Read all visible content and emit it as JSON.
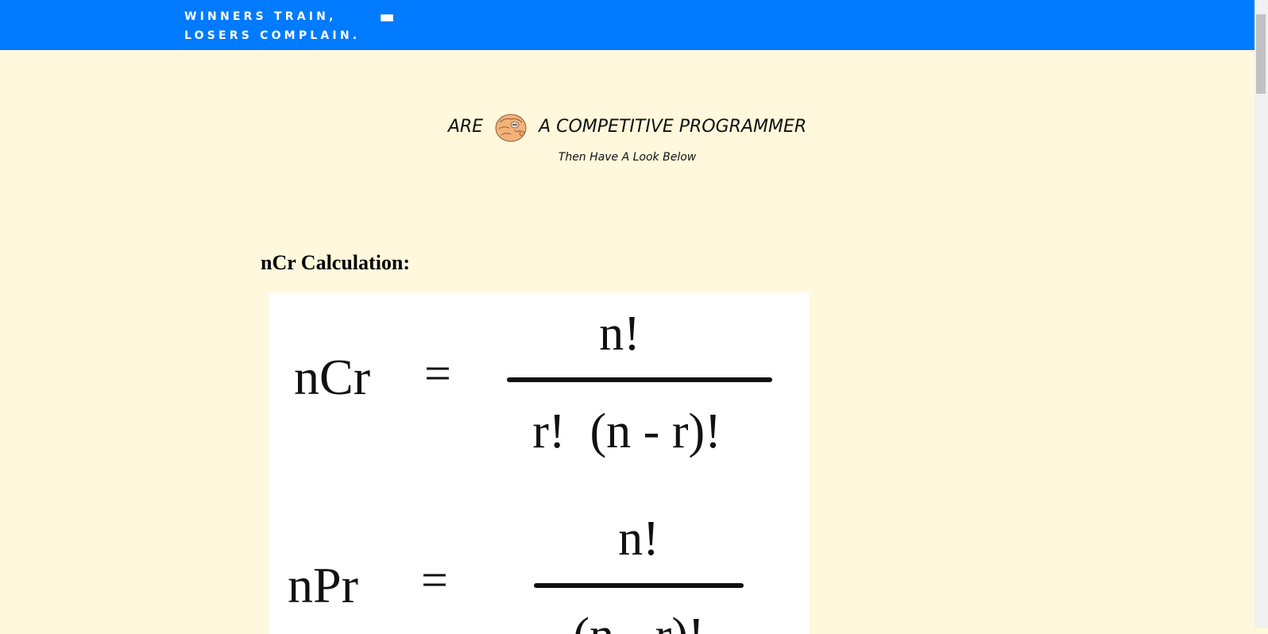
{
  "navbar": {
    "brand_line1": "WINNERS TRAIN,",
    "brand_line2": "LOSERS COMPLAIN.",
    "toggler_icon": "menu-toggler-icon",
    "color": "#007bff"
  },
  "hero": {
    "title_before": "ARE",
    "title_after": "A COMPETITIVE PROGRAMMER",
    "hand_icon": "pointing-hand-icon",
    "subtitle": "Then Have A Look Below"
  },
  "section": {
    "heading": "nCr Calculation:"
  },
  "formulas": {
    "ncr_lhs": "nCr",
    "ncr_eq": "=",
    "ncr_numerator": "n!",
    "ncr_denominator": "r!  (n - r)!",
    "npr_lhs": "nPr",
    "npr_eq": "=",
    "npr_numerator": "n!",
    "npr_denominator": "(n - r)!"
  },
  "page": {
    "background": "#fff8dc"
  }
}
